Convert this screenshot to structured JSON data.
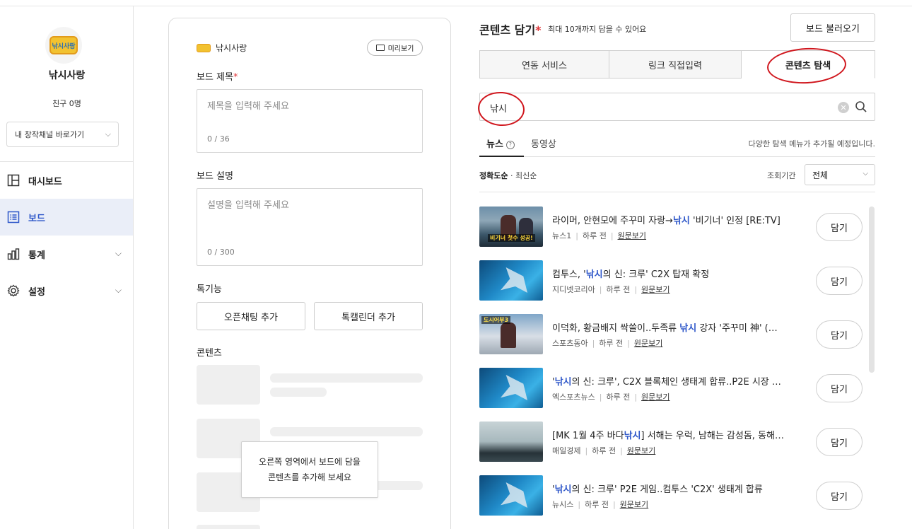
{
  "sidebar": {
    "logo_text": "낚시사랑",
    "channel_name": "낚시사랑",
    "friends": "친구 0명",
    "channel_select": "내 창작채널 바로가기",
    "nav": [
      {
        "label": "대시보드",
        "icon": "layout-icon"
      },
      {
        "label": "보드",
        "icon": "list-icon"
      },
      {
        "label": "통계",
        "icon": "bar-chart-icon"
      },
      {
        "label": "설정",
        "icon": "gear-icon"
      }
    ]
  },
  "editor": {
    "brand": "낚시사랑",
    "preview_label": "미리보기",
    "title_label": "보드 제목",
    "title_placeholder": "제목을 입력해 주세요",
    "title_count": "0 / 36",
    "desc_label": "보드 설명",
    "desc_placeholder": "설명을 입력해 주세요",
    "desc_count": "0 / 300",
    "features_label": "톡기능",
    "openchat_button": "오픈채팅 추가",
    "talkcal_button": "톡캘린더 추가",
    "contents_label": "콘텐츠",
    "tooltip_line1": "오른쪽 영역에서 보드에 담을",
    "tooltip_line2": "콘텐츠를 추가해 보세요"
  },
  "right": {
    "title": "콘텐츠 담기",
    "required_mark": "*",
    "subtitle": "최대 10개까지 담을 수 있어요",
    "load_button": "보드 불러오기",
    "tabs": [
      "연동 서비스",
      "링크 직접입력",
      "콘텐츠 탐색"
    ],
    "active_tab": "콘텐츠 탐색",
    "search_value": "낚시",
    "subtabs": [
      "뉴스",
      "동영상"
    ],
    "subnote": "다양한 탐색 메뉴가 추가될 예정입니다.",
    "sort_accuracy": "정확도순",
    "sort_dot": "·",
    "sort_latest": "최신순",
    "period_label": "조회기간",
    "period_value": "전체",
    "add_label": "담기",
    "items": [
      {
        "pre": "라이머, 안현모에 주꾸미 자랑→",
        "hl": "낚시",
        "post": " '비기너' 인정 [RE:TV]",
        "source": "뉴스1",
        "time": "하루 전",
        "link": "원문보기",
        "thumb": "boat",
        "caption": "비기너 첫수 성공!"
      },
      {
        "pre": "컴투스, '",
        "hl": "낚시",
        "post": "의 신: 크루' C2X 탑재 확정",
        "source": "지디넷코리아",
        "time": "하루 전",
        "link": "원문보기",
        "thumb": "blue",
        "caption": ""
      },
      {
        "pre": "이덕화, 황금배지 싹쓸이..두족류 ",
        "hl": "낚시",
        "post": " 강자 '주꾸미 神' (…",
        "source": "스포츠동아",
        "time": "하루 전",
        "link": "원문보기",
        "thumb": "ice",
        "caption": "도시어부3"
      },
      {
        "pre": "'",
        "hl": "낚시",
        "post": "의 신: 크루', C2X 블록체인 생태계 합류..P2E 시장 …",
        "source": "엑스포츠뉴스",
        "time": "하루 전",
        "link": "원문보기",
        "thumb": "blue",
        "caption": ""
      },
      {
        "pre": "[MK 1월 4주 바다",
        "hl": "낚시",
        "post": "] 서해는 우럭, 남해는 감성돔, 동해…",
        "source": "매일경제",
        "time": "하루 전",
        "link": "원문보기",
        "thumb": "sea",
        "caption": ""
      },
      {
        "pre": "'",
        "hl": "낚시",
        "post": "의 신: 크루' P2E 게임..컴투스 'C2X' 생태계 합류",
        "source": "뉴시스",
        "time": "하루 전",
        "link": "원문보기",
        "thumb": "blue",
        "caption": ""
      }
    ]
  },
  "colors": {
    "accent": "#2d56c9",
    "annotation": "#d0161d",
    "required": "#e0383b"
  }
}
